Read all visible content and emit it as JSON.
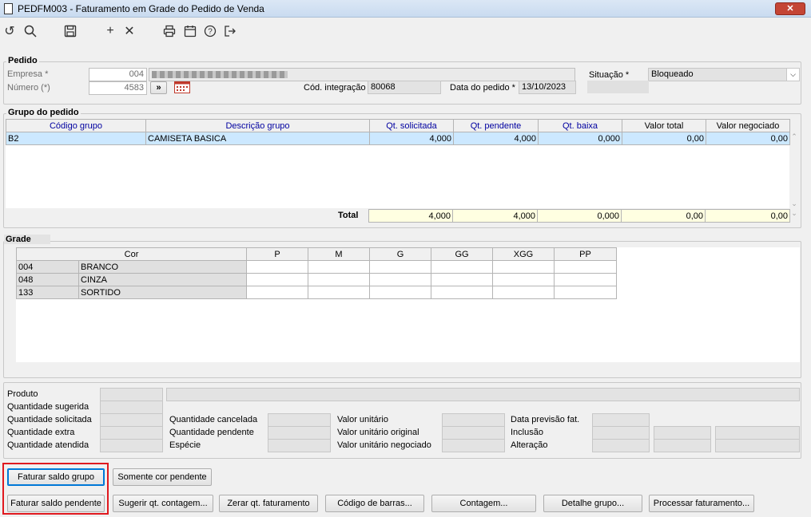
{
  "window": {
    "title": "PEDFM003 - Faturamento em Grade do Pedido de Venda",
    "close_icon": "close-icon"
  },
  "toolbar": {
    "icons": [
      "undo-icon",
      "search-icon",
      "save-icon",
      "add-icon",
      "delete-icon",
      "print-icon",
      "calendar-icon",
      "help-icon",
      "exit-icon"
    ]
  },
  "pedido": {
    "legend": "Pedido",
    "empresa_label": "Empresa *",
    "empresa_value": "004",
    "numero_label": "Número (*)",
    "numero_value": "4583",
    "nav_button": "»",
    "cod_integracao_label": "Cód. integração",
    "cod_integracao_value": "80068",
    "data_pedido_label": "Data do pedido *",
    "data_pedido_value": "13/10/2023",
    "situacao_label": "Situação *",
    "situacao_value": "Bloqueado"
  },
  "grupo": {
    "legend": "Grupo do pedido",
    "columns": [
      "Código grupo",
      "Descrição grupo",
      "Qt. solicitada",
      "Qt. pendente",
      "Qt. baixa",
      "Valor total",
      "Valor  negociado"
    ],
    "rows": [
      [
        "B2",
        "CAMISETA BASICA",
        "4,000",
        "4,000",
        "0,000",
        "0,00",
        "0,00"
      ]
    ],
    "total_label": "Total",
    "totals": [
      "4,000",
      "4,000",
      "0,000",
      "0,00",
      "0,00"
    ]
  },
  "grade": {
    "legend": "Grade",
    "columns": [
      "Cor",
      "P",
      "M",
      "G",
      "GG",
      "XGG",
      "PP"
    ],
    "rows": [
      [
        "004",
        "BRANCO"
      ],
      [
        "048",
        "CINZA"
      ],
      [
        "133",
        "SORTIDO"
      ]
    ]
  },
  "info": {
    "produto": "Produto",
    "qtd_sugerida": "Quantidade sugerida",
    "qtd_solicitada": "Quantidade solicitada",
    "qtd_extra": "Quantidade extra",
    "qtd_atendida": "Quantidade atendida",
    "qtd_cancelada": "Quantidade cancelada",
    "qtd_pendente": "Quantidade pendente",
    "especie": "Espécie",
    "valor_unitario": "Valor unitário",
    "valor_unitario_original": "Valor unitário original",
    "valor_unitario_negociado": "Valor unitário negociado",
    "data_previsao": "Data previsão fat.",
    "inclusao": "Inclusão",
    "alteracao": "Alteração"
  },
  "buttons": {
    "faturar_saldo_grupo": "Faturar saldo grupo",
    "somente_cor_pendente": "Somente cor pendente",
    "faturar_saldo_pendente": "Faturar saldo pendente",
    "sugerir_contagem": "Sugerir qt. contagem...",
    "zerar_faturamento": "Zerar qt. faturamento",
    "codigo_barras": "Código de barras...",
    "contagem": "Contagem...",
    "detalhe_grupo": "Detalhe grupo...",
    "processar_faturamento": "Processar faturamento..."
  },
  "colors": {
    "selected_row": "#cce8ff",
    "totals_bg": "#ffffe1",
    "highlight_border": "#e0191f",
    "accent_border": "#0078d7"
  }
}
